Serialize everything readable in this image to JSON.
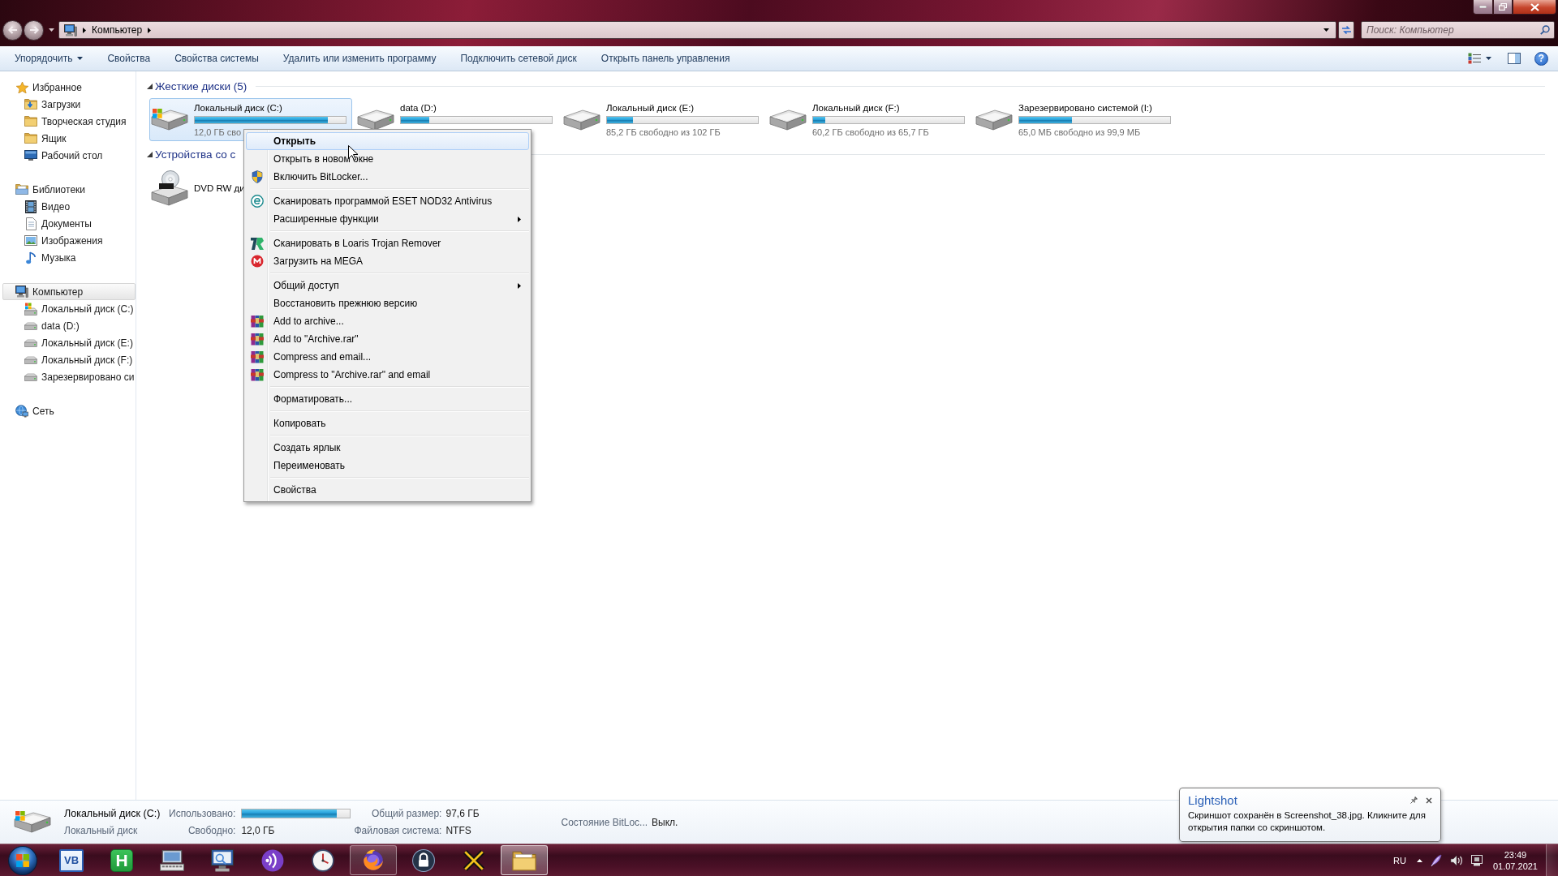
{
  "address_bar": {
    "path": [
      "Компьютер"
    ]
  },
  "search": {
    "placeholder": "Поиск: Компьютер"
  },
  "toolbar": {
    "buttons": [
      {
        "label": "Упорядочить",
        "dropdown": true
      },
      {
        "label": "Свойства",
        "dropdown": false
      },
      {
        "label": "Свойства системы",
        "dropdown": false
      },
      {
        "label": "Удалить или изменить программу",
        "dropdown": false
      },
      {
        "label": "Подключить сетевой диск",
        "dropdown": false
      },
      {
        "label": "Открыть панель управления",
        "dropdown": false
      }
    ],
    "help": "?"
  },
  "sidebar": {
    "groups": [
      {
        "label": "Избранное",
        "selected": false,
        "children": [
          {
            "label": "Загрузки",
            "selected": false
          },
          {
            "label": "Творческая студия",
            "selected": false
          },
          {
            "label": "Ящик",
            "selected": false
          },
          {
            "label": "Рабочий стол",
            "selected": false
          }
        ]
      },
      {
        "label": "Библиотеки",
        "selected": false,
        "children": [
          {
            "label": "Видео",
            "selected": false
          },
          {
            "label": "Документы",
            "selected": false
          },
          {
            "label": "Изображения",
            "selected": false
          },
          {
            "label": "Музыка",
            "selected": false
          }
        ]
      },
      {
        "label": "Компьютер",
        "selected": true,
        "children": [
          {
            "label": "Локальный диск (C:)",
            "selected": false
          },
          {
            "label": "data (D:)",
            "selected": false
          },
          {
            "label": "Локальный диск (E:)",
            "selected": false
          },
          {
            "label": "Локальный диск (F:)",
            "selected": false
          },
          {
            "label": "Зарезервировано си",
            "selected": false
          }
        ]
      },
      {
        "label": "Сеть",
        "selected": false
      }
    ]
  },
  "drive_groups": [
    {
      "title": "Жесткие диски (5)",
      "expanded": true,
      "items": [
        {
          "kind": "disk",
          "name": "Локальный диск (C:)",
          "selected": true,
          "level": 0.88,
          "free": "12,0 ГБ сво"
        },
        {
          "kind": "disk",
          "name": "data (D:)",
          "selected": false,
          "level": 0.19
        },
        {
          "kind": "disk",
          "name": "Локальный диск (E:)",
          "selected": false,
          "level": 0.17,
          "free": "85,2 ГБ свободно из 102 ГБ"
        },
        {
          "kind": "disk",
          "name": "Локальный диск (F:)",
          "selected": false,
          "level": 0.08,
          "free": "60,2 ГБ свободно из 65,7 ГБ"
        },
        {
          "kind": "disk",
          "name": "Зарезервировано системой (I:)",
          "selected": false,
          "level": 0.35,
          "free": "65,0 МБ свободно из 99,9 МБ"
        }
      ]
    },
    {
      "title": "Устройства со с",
      "expanded": true,
      "items": [
        {
          "kind": "optical",
          "name": "DVD RW ди",
          "selected": false
        }
      ]
    }
  ],
  "context_menu": {
    "sections": [
      {
        "items": [
          {
            "label": "Открыть",
            "default": true,
            "selected": true,
            "submenu": false
          },
          {
            "label": "Открыть в новом окне",
            "default": false,
            "selected": false,
            "submenu": false
          },
          {
            "label": "Включить BitLocker...",
            "default": false,
            "selected": false,
            "submenu": false
          }
        ]
      },
      {
        "items": [
          {
            "label": "Сканировать программой ESET NOD32 Antivirus",
            "default": false,
            "selected": false,
            "submenu": false
          },
          {
            "label": "Расширенные функции",
            "default": false,
            "selected": false,
            "submenu": true
          }
        ]
      },
      {
        "items": [
          {
            "label": "Сканировать в Loaris Trojan Remover",
            "default": false,
            "selected": false,
            "submenu": false
          },
          {
            "label": "Загрузить на MEGA",
            "default": false,
            "selected": false,
            "submenu": false
          }
        ]
      },
      {
        "items": [
          {
            "label": "Общий доступ",
            "default": false,
            "selected": false,
            "submenu": true
          },
          {
            "label": "Восстановить прежнюю версию",
            "default": false,
            "selected": false,
            "submenu": false
          },
          {
            "label": "Add to archive...",
            "default": false,
            "selected": false,
            "submenu": false
          },
          {
            "label": "Add to \"Archive.rar\"",
            "default": false,
            "selected": false,
            "submenu": false
          },
          {
            "label": "Compress and email...",
            "default": false,
            "selected": false,
            "submenu": false
          },
          {
            "label": "Compress to \"Archive.rar\" and email",
            "default": false,
            "selected": false,
            "submenu": false
          }
        ]
      },
      {
        "items": [
          {
            "label": "Форматировать...",
            "default": false,
            "selected": false,
            "submenu": false
          }
        ]
      },
      {
        "items": [
          {
            "label": "Копировать",
            "default": false,
            "selected": false,
            "submenu": false
          }
        ]
      },
      {
        "items": [
          {
            "label": "Создать ярлык",
            "default": false,
            "selected": false,
            "submenu": false
          },
          {
            "label": "Переименовать",
            "default": false,
            "selected": false,
            "submenu": false
          }
        ]
      },
      {
        "items": [
          {
            "label": "Свойства",
            "default": false,
            "selected": false,
            "submenu": false
          }
        ]
      }
    ]
  },
  "details": {
    "name": "Локальный диск (C:)",
    "type": "Локальный диск",
    "columns": [
      [
        {
          "label": "Использовано:",
          "level": 0.88
        },
        {
          "label": "Свободно:",
          "value": "12,0 ГБ"
        }
      ],
      [
        {
          "label": "Общий размер:",
          "value": "97,6 ГБ"
        },
        {
          "label": "Файловая система:",
          "value": "NTFS"
        }
      ],
      [
        {
          "label": "Состояние BitLoc...",
          "value": "Выкл."
        }
      ]
    ]
  },
  "notification": {
    "title": "Lightshot",
    "text": "Скриншот сохранён в Screenshot_38.jpg. Кликните для открытия папки со скриншотом."
  },
  "taskbar": {
    "buttons": [
      {
        "glyph": "VB",
        "running": false,
        "selected": false
      },
      {
        "glyph": "H",
        "running": false,
        "selected": false
      },
      {
        "running": false,
        "selected": false
      },
      {
        "running": false,
        "selected": false
      },
      {
        "running": false,
        "selected": false
      },
      {
        "running": false,
        "selected": false
      },
      {
        "running": true,
        "selected": false
      },
      {
        "running": false,
        "selected": false
      },
      {
        "running": false,
        "selected": false
      },
      {
        "running": true,
        "selected": true
      }
    ]
  },
  "tray": {
    "language": "RU",
    "time": "23:49",
    "date": "01.07.2021"
  }
}
